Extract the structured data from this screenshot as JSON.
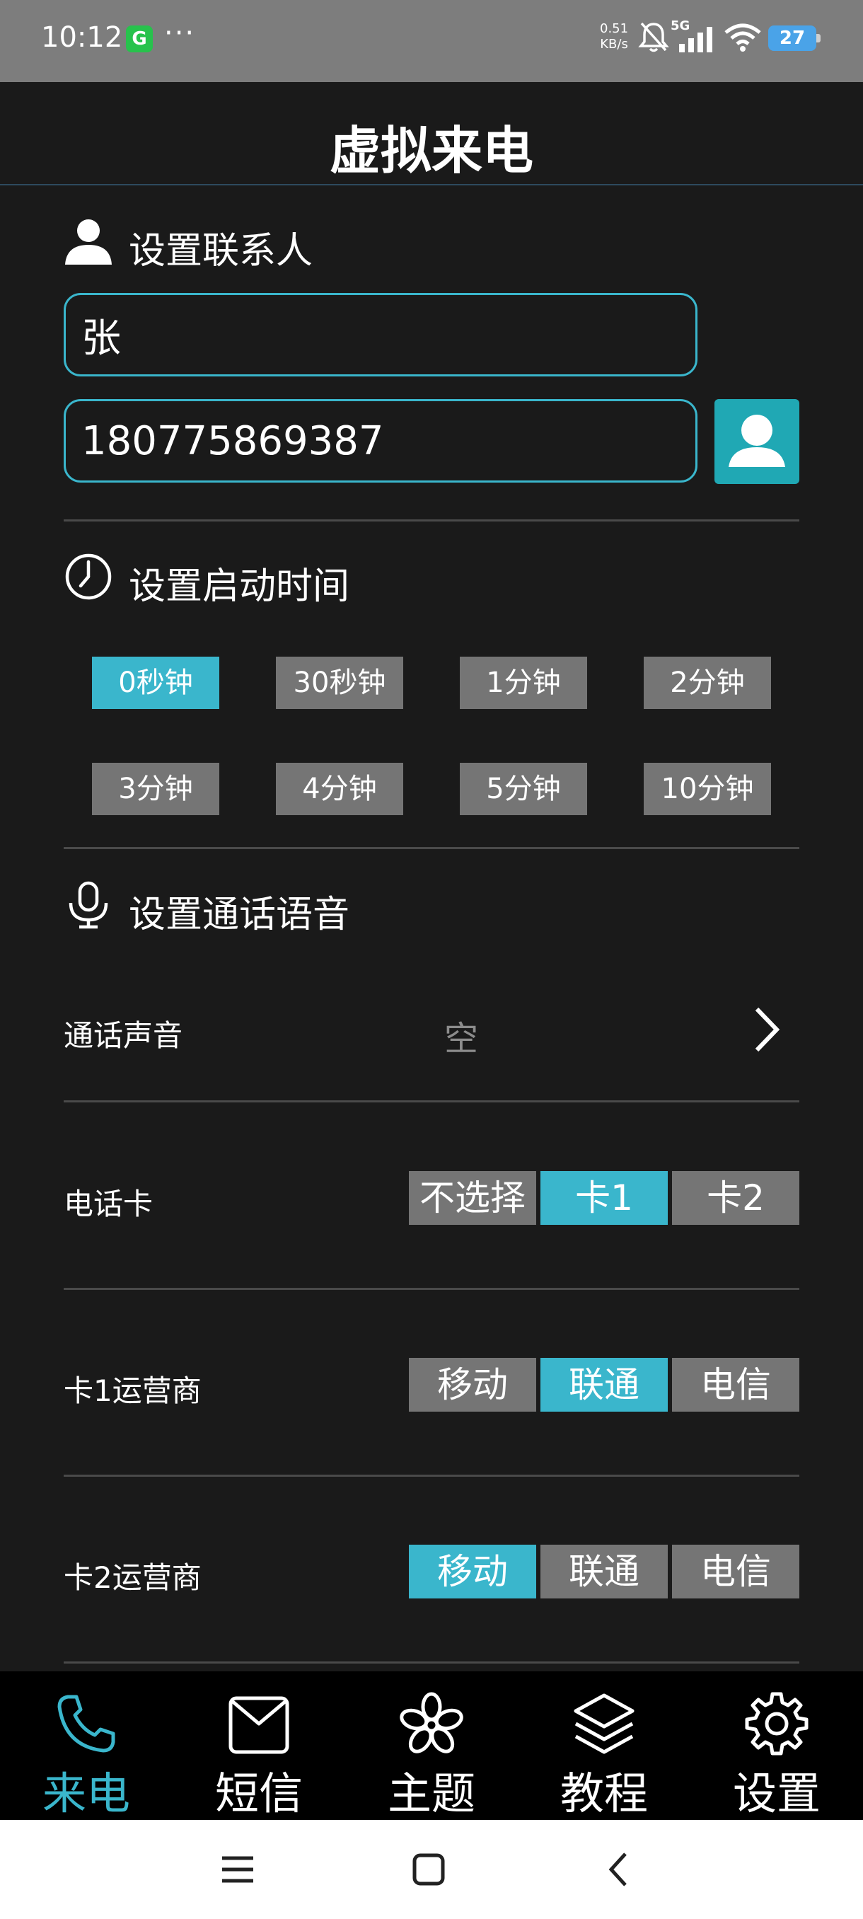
{
  "status_bar": {
    "time": "10:12",
    "app_badge": "G",
    "more": "···",
    "net_speed_value": "0.51",
    "net_speed_unit": "KB/s",
    "network": "5G",
    "battery": "27"
  },
  "header": {
    "title": "虚拟来电"
  },
  "contact": {
    "section_title": "设置联系人",
    "name_value": "张",
    "phone_value": "180775869387"
  },
  "start_time": {
    "section_title": "设置启动时间",
    "options": [
      "0秒钟",
      "30秒钟",
      "1分钟",
      "2分钟",
      "3分钟",
      "4分钟",
      "5分钟",
      "10分钟"
    ],
    "selected": "0秒钟"
  },
  "voice": {
    "section_title": "设置通话语音",
    "call_sound_label": "通话声音",
    "call_sound_value": "空",
    "sim_card": {
      "label": "电话卡",
      "options": [
        "不选择",
        "卡1",
        "卡2"
      ],
      "selected": "卡1"
    },
    "card1_carrier": {
      "label": "卡1运营商",
      "options": [
        "移动",
        "联通",
        "电信"
      ],
      "selected": "联通"
    },
    "card2_carrier": {
      "label": "卡2运营商",
      "options": [
        "移动",
        "联通",
        "电信"
      ],
      "selected": "移动"
    }
  },
  "bottom_nav": {
    "items": [
      {
        "label": "来电",
        "icon": "phone-icon"
      },
      {
        "label": "短信",
        "icon": "envelope-icon"
      },
      {
        "label": "主题",
        "icon": "flower-icon"
      },
      {
        "label": "教程",
        "icon": "layers-icon"
      },
      {
        "label": "设置",
        "icon": "gear-icon"
      }
    ],
    "active": "来电"
  },
  "colors": {
    "accent": "#3ab6cc",
    "button_gray": "#757575",
    "background": "#1a1a1a",
    "status_bar": "#7d7d7d"
  }
}
